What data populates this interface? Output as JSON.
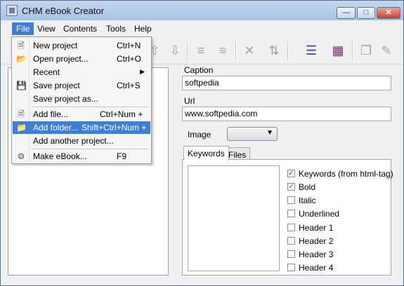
{
  "window": {
    "title": "CHM eBook Creator"
  },
  "menubar": {
    "items": [
      "File",
      "View",
      "Contents",
      "Tools",
      "Help"
    ]
  },
  "file_menu": {
    "items": [
      {
        "label": "New project",
        "shortcut": "Ctrl+N",
        "icon": "new-document-icon"
      },
      {
        "label": "Open project...",
        "shortcut": "Ctrl+O",
        "icon": "open-folder-icon"
      },
      {
        "label": "Recent",
        "shortcut": "",
        "icon": "",
        "submenu": true
      },
      {
        "label": "Save project",
        "shortcut": "Ctrl+S",
        "icon": "save-icon"
      },
      {
        "label": "Save project as...",
        "shortcut": "",
        "icon": ""
      },
      {
        "label": "Add file...",
        "shortcut": "Ctrl+Num +",
        "icon": "add-file-icon"
      },
      {
        "label": "Add folder...",
        "shortcut": "Shift+Ctrl+Num +",
        "icon": "add-folder-icon",
        "highlighted": true
      },
      {
        "label": "Add another project...",
        "shortcut": "",
        "icon": ""
      },
      {
        "label": "Make eBook...",
        "shortcut": "F9",
        "icon": "make-ebook-icon"
      }
    ]
  },
  "toolbar": {
    "icons": [
      "move-up-icon",
      "move-down-icon",
      "indent-icon",
      "outdent-icon",
      "delete-icon",
      "sort-icon",
      "checklist-icon",
      "books-icon",
      "copy-icon",
      "edit-icon"
    ]
  },
  "properties": {
    "caption_label": "Caption",
    "caption_value": "softpedia",
    "url_label": "Url",
    "url_value": "www.softpedia.com",
    "image_label": "Image",
    "image_value": ""
  },
  "tabs": [
    "Keywords",
    "Files"
  ],
  "keyword_options": [
    {
      "label": "Keywords (from html-tag)",
      "checked": true
    },
    {
      "label": "Bold",
      "checked": true
    },
    {
      "label": "Italic",
      "checked": false
    },
    {
      "label": "Underlined",
      "checked": false
    },
    {
      "label": "Header 1",
      "checked": false
    },
    {
      "label": "Header 2",
      "checked": false
    },
    {
      "label": "Header 3",
      "checked": false
    },
    {
      "label": "Header 4",
      "checked": false
    }
  ],
  "colors": {
    "highlight": "#3d7fd6",
    "titlebar": "#b7cdea"
  }
}
